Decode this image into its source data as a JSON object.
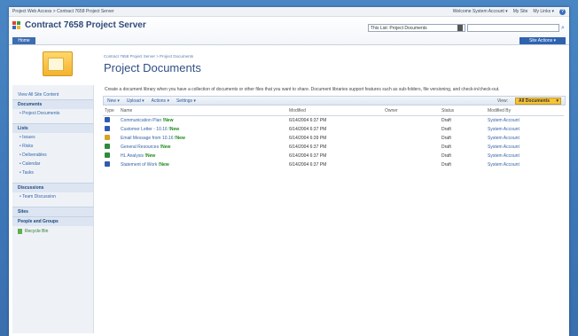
{
  "topbar": {
    "breadcrumb": "Project Web Access > Contract 7658 Project Server",
    "welcome": "Welcome System Account ▾",
    "my_site": "My Site",
    "my_links": "My Links ▾"
  },
  "header": {
    "site_title": "Contract 7658 Project Server",
    "home_tab": "Home",
    "scope_selected": "This List: Project Documents",
    "site_actions": "Site Actions ▾"
  },
  "title_area": {
    "breadcrumb": "Contract 7658 Project Server > Project Documents",
    "page_title": "Project Documents"
  },
  "leftnav": {
    "view_all": "View All Site Content",
    "sections": [
      {
        "heading": "Documents",
        "items": [
          "Project Documents"
        ]
      },
      {
        "heading": "Lists",
        "items": [
          "Issues",
          "Risks",
          "Deliverables",
          "Calendar",
          "Tasks"
        ]
      },
      {
        "heading": "Discussions",
        "items": [
          "Team Discussion"
        ]
      },
      {
        "heading": "Sites",
        "items": []
      },
      {
        "heading": "People and Groups",
        "items": []
      }
    ],
    "recycle_bin": "Recycle Bin"
  },
  "main": {
    "description": "Create a document library when you have a collection of documents or other files that you want to share. Document libraries support features such as sub-folders, file versioning, and check-in/check-out.",
    "toolbar": {
      "new": "New ▾",
      "upload": "Upload ▾",
      "actions": "Actions ▾",
      "settings": "Settings ▾",
      "view_label": "View:",
      "view_selected": "All Documents"
    },
    "columns": [
      "Type",
      "Name",
      "Modified",
      "Owner",
      "Status",
      "Modified By"
    ],
    "rows": [
      {
        "type": "word-icon",
        "name": "Communication Plan",
        "is_new": true,
        "modified": "6/14/2004 6:37 PM",
        "owner": "",
        "status": "Draft",
        "modified_by": "System Account"
      },
      {
        "type": "word-icon",
        "name": "Customer Letter - 10.16",
        "is_new": true,
        "modified": "6/14/2004 6:37 PM",
        "owner": "",
        "status": "Draft",
        "modified_by": "System Account"
      },
      {
        "type": "email-icon",
        "name": "Email Message from 10.16",
        "is_new": true,
        "modified": "6/14/2004 6:39 PM",
        "owner": "",
        "status": "Draft",
        "modified_by": "System Account"
      },
      {
        "type": "excel-icon",
        "name": "General Resources",
        "is_new": true,
        "modified": "6/14/2004 6:37 PM",
        "owner": "",
        "status": "Draft",
        "modified_by": "System Account"
      },
      {
        "type": "excel-icon",
        "name": "HL Analysis",
        "is_new": true,
        "modified": "6/14/2004 6:37 PM",
        "owner": "",
        "status": "Draft",
        "modified_by": "System Account"
      },
      {
        "type": "word-icon",
        "name": "Statement of Work",
        "is_new": true,
        "modified": "6/14/2004 6:37 PM",
        "owner": "",
        "status": "Draft",
        "modified_by": "System Account"
      }
    ],
    "new_badge": "!New"
  },
  "colors": {
    "background": "#3d77b8",
    "accent": "#2f63b0",
    "view_select": "#f6c338",
    "new_badge": "#1a8a1a",
    "word_icon": "#2f5bb0",
    "excel_icon": "#2e8b3a",
    "email_icon": "#d9a520"
  }
}
